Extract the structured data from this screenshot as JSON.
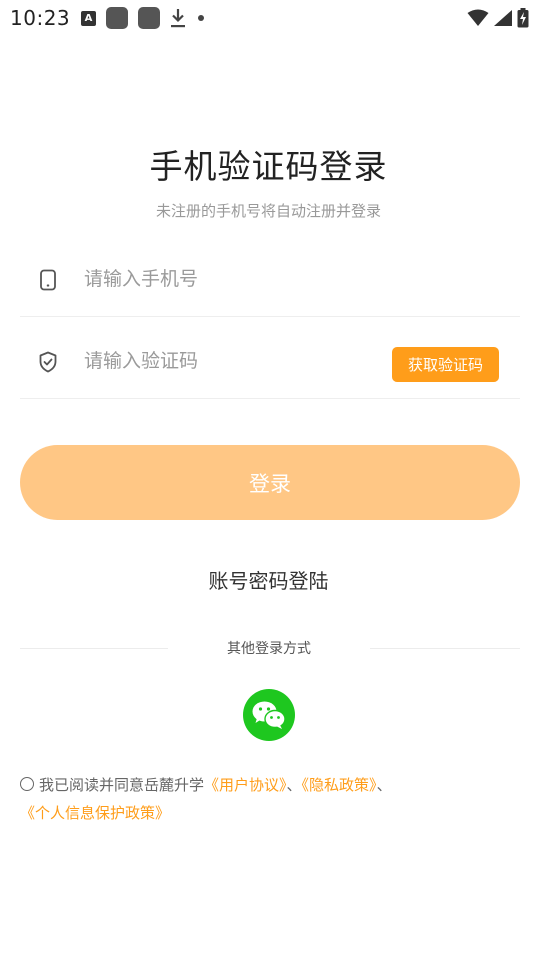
{
  "status_bar": {
    "time": "10:23",
    "icons": [
      "text-a-icon",
      "app-square-icon",
      "app-square-icon",
      "download-icon",
      "dot-icon",
      "wifi-icon",
      "signal-icon",
      "battery-charging-icon"
    ]
  },
  "header": {
    "title": "手机验证码登录",
    "subtitle": "未注册的手机号将自动注册并登录"
  },
  "form": {
    "phone_placeholder": "请输入手机号",
    "phone_value": "",
    "code_placeholder": "请输入验证码",
    "code_value": "",
    "get_code_label": "获取验证码",
    "login_label": "登录"
  },
  "password_login_label": "账号密码登陆",
  "other_login": {
    "label": "其他登录方式",
    "methods": [
      "wechat-icon"
    ]
  },
  "agreement": {
    "prefix": "我已阅读并同意岳麓升学",
    "user_agreement": "《用户协议》",
    "separator1": "、",
    "privacy_policy": "《隐私政策》",
    "separator2": "、",
    "personal_info_policy": "《个人信息保护政策》"
  },
  "colors": {
    "accent": "#ff9d1a",
    "login_button": "#ffc785",
    "wechat": "#1ec71f"
  }
}
